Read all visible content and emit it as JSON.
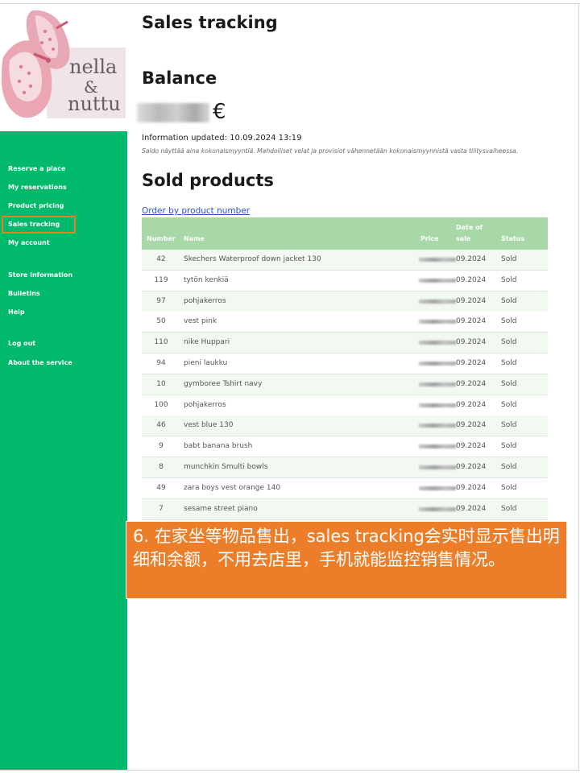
{
  "logo": {
    "text_line1": "nella",
    "text_line2": "&",
    "text_line3": "nuttu"
  },
  "sidebar": {
    "items": [
      {
        "label": "Reserve a place"
      },
      {
        "label": "My reservations"
      },
      {
        "label": "Product pricing"
      },
      {
        "label": "Sales tracking",
        "active": true
      },
      {
        "label": "My account"
      },
      {
        "label": "Store information"
      },
      {
        "label": "Bulletins"
      },
      {
        "label": "Help"
      },
      {
        "label": "Log out"
      },
      {
        "label": "About the service"
      }
    ]
  },
  "page": {
    "title": "Sales tracking",
    "balance_heading": "Balance",
    "currency": "€",
    "info_updated": "Information updated: 10.09.2024 13:19",
    "note": "Saldo näyttää aina kokonaismyyntiä. Mahdolliset velat ja provisiot vähennetään kokonaismyynnistä vasta tilitysvaiheessa.",
    "sold_heading": "Sold products",
    "order_link": "Order by product number"
  },
  "table": {
    "headers": {
      "number": "Number",
      "name": "Name",
      "price": "Price",
      "date_line1": "Date of",
      "date_line2": "sale",
      "status": "Status"
    },
    "rows": [
      {
        "number": "42",
        "name": "Skechers Waterproof down jacket 130",
        "date": "09.2024",
        "status": "Sold"
      },
      {
        "number": "119",
        "name": "tytön kenkiä",
        "date": "09.2024",
        "status": "Sold"
      },
      {
        "number": "97",
        "name": "pohjakerros",
        "date": "09.2024",
        "status": "Sold"
      },
      {
        "number": "50",
        "name": "vest pink",
        "date": "09.2024",
        "status": "Sold"
      },
      {
        "number": "110",
        "name": "nike Huppari",
        "date": "09.2024",
        "status": "Sold"
      },
      {
        "number": "94",
        "name": "pieni laukku",
        "date": "09.2024",
        "status": "Sold"
      },
      {
        "number": "10",
        "name": "gymboree Tshirt navy",
        "date": "09.2024",
        "status": "Sold"
      },
      {
        "number": "100",
        "name": "pohjakerros",
        "date": "09.2024",
        "status": "Sold"
      },
      {
        "number": "46",
        "name": "vest blue 130",
        "date": "09.2024",
        "status": "Sold"
      },
      {
        "number": "9",
        "name": "babt banana brush",
        "date": "09.2024",
        "status": "Sold"
      },
      {
        "number": "8",
        "name": "munchkin Smulti bowls",
        "date": "09.2024",
        "status": "Sold"
      },
      {
        "number": "49",
        "name": "zara boys vest orange 140",
        "date": "09.2024",
        "status": "Sold"
      },
      {
        "number": "7",
        "name": "sesame street piano",
        "date": "09.2024",
        "status": "Sold"
      }
    ]
  },
  "banner": {
    "text": "6. 在家坐等物品售出，sales tracking会实时显示售出明细和余额，不用去店里，手机就能监控销售情况。"
  },
  "colors": {
    "sidebar_green": "#00b96b",
    "header_green": "#a8d8a8",
    "banner_orange": "#ec7e2a",
    "link_blue": "#2a4fd6"
  }
}
